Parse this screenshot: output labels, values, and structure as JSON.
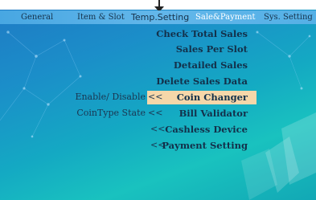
{
  "tabs": [
    {
      "label": "General"
    },
    {
      "label": "Item & Slot"
    },
    {
      "label": "Temp.Setting"
    },
    {
      "label": "Sale&Payment"
    },
    {
      "label": "Sys. Setting"
    }
  ],
  "active_tab": "Sale&Payment",
  "menu": {
    "check_total_sales": "Check Total Sales",
    "sales_per_slot": "Sales Per Slot",
    "detailed_sales": "Detailed Sales",
    "delete_sales_data": "Delete Sales Data",
    "coin_changer": "Coin Changer",
    "bill_validator": "Bill Validator",
    "cashless_device": "Cashless Device",
    "payment_setting": "Payment Setting"
  },
  "sub_labels": {
    "enable_disable": "Enable/ Disable",
    "cointype_state": "CoinType State"
  },
  "marker": "<<",
  "colors": {
    "selection_bg": "#f6d7a9",
    "tab_bar": "#63b7ea",
    "text": "#13304a"
  },
  "icons": {
    "top_marker": "down-arrow-icon"
  }
}
